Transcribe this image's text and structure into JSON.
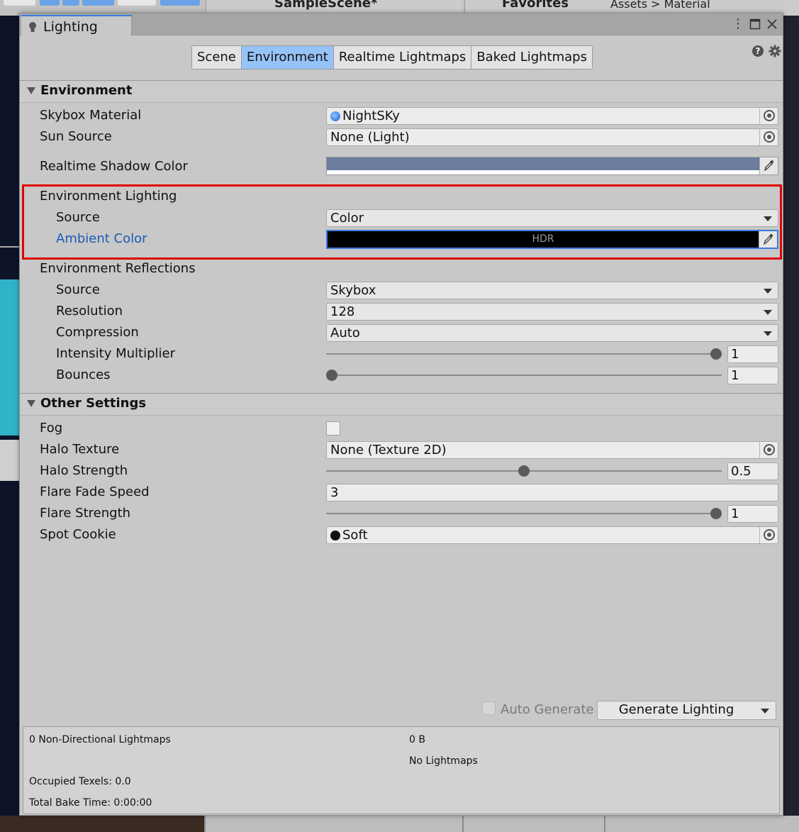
{
  "background": {
    "scene_tab": "SampleScene*",
    "favorites_tab": "Favorites",
    "breadcrumb": "Assets > Material"
  },
  "window": {
    "title": "Lighting"
  },
  "tabs": [
    "Scene",
    "Environment",
    "Realtime Lightmaps",
    "Baked Lightmaps"
  ],
  "active_tab": "Environment",
  "environment": {
    "header": "Environment",
    "skybox_material": {
      "label": "Skybox Material",
      "value": "NightSKy"
    },
    "sun_source": {
      "label": "Sun Source",
      "value": "None (Light)"
    },
    "realtime_shadow_color": {
      "label": "Realtime Shadow Color",
      "color": "#6d7c9f"
    },
    "lighting": {
      "label": "Environment Lighting",
      "source": {
        "label": "Source",
        "value": "Color"
      },
      "ambient_color": {
        "label": "Ambient Color",
        "hdr": "HDR",
        "color": "#000000"
      }
    },
    "reflections": {
      "label": "Environment Reflections",
      "source": {
        "label": "Source",
        "value": "Skybox"
      },
      "resolution": {
        "label": "Resolution",
        "value": "128"
      },
      "compression": {
        "label": "Compression",
        "value": "Auto"
      },
      "intensity_multiplier": {
        "label": "Intensity Multiplier",
        "value": "1",
        "slider_fraction": 1.0
      },
      "bounces": {
        "label": "Bounces",
        "value": "1",
        "slider_fraction": 0.0
      }
    }
  },
  "other_settings": {
    "header": "Other Settings",
    "fog": {
      "label": "Fog",
      "checked": false
    },
    "halo_texture": {
      "label": "Halo Texture",
      "value": "None (Texture 2D)"
    },
    "halo_strength": {
      "label": "Halo Strength",
      "value": "0.5",
      "slider_fraction": 0.5
    },
    "flare_fade_speed": {
      "label": "Flare Fade Speed",
      "value": "3"
    },
    "flare_strength": {
      "label": "Flare Strength",
      "value": "1",
      "slider_fraction": 1.0
    },
    "spot_cookie": {
      "label": "Spot Cookie",
      "value": "Soft"
    }
  },
  "footer": {
    "auto_generate_label": "Auto Generate",
    "auto_generate_checked": false,
    "generate_button": "Generate Lighting"
  },
  "stats": {
    "lightmaps": "0 Non-Directional Lightmaps",
    "size": "0 B",
    "no_lightmaps": "No Lightmaps",
    "occupied_texels": "Occupied Texels: 0.0",
    "total_bake_time": "Total Bake Time: 0:00:00"
  },
  "colors": {
    "accent": "#3a7be0",
    "active_tab": "#96c3f7",
    "highlight_box": "#e00000",
    "link_label": "#1a5bb5"
  }
}
